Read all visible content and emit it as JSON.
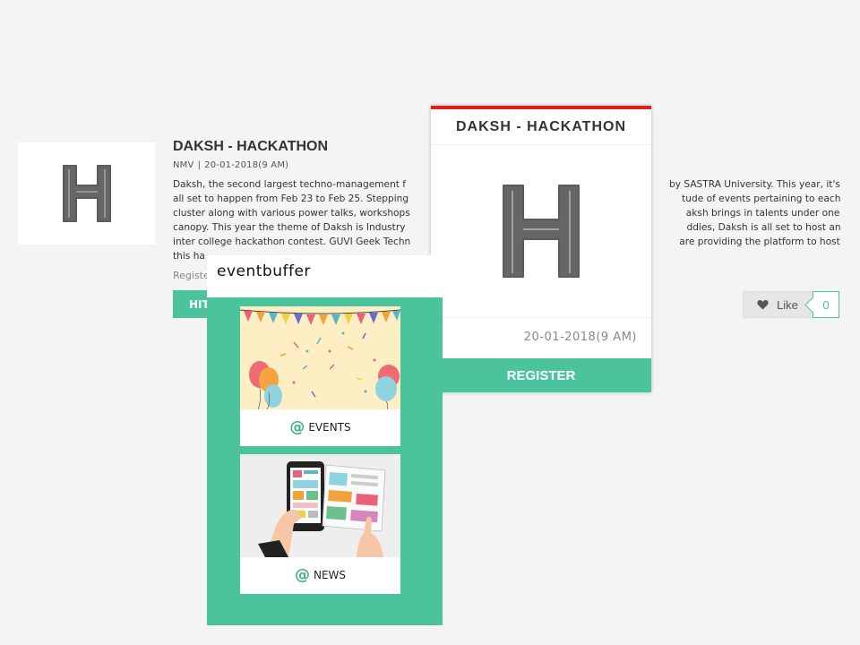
{
  "listing": {
    "title": "DAKSH - HACKATHON",
    "meta_left": "NMV",
    "meta_sep": "|",
    "meta_date": "20-01-2018(9 AM)",
    "desc_lines": [
      [
        "Daksh, the second largest techno-management f",
        "by SASTRA University. This year, it's"
      ],
      [
        "all set to happen from Feb 23 to Feb 25. Stepping",
        "tude of events pertaining to each"
      ],
      [
        "cluster along with various power talks, workshops",
        "aksh brings in talents under one"
      ],
      [
        "canopy. This year the theme of Daksh is Industry",
        "ddies, Daksh is all set to host an"
      ],
      [
        "inter college hackathon contest. GUVI Geek Techn",
        "are providing the platform to host"
      ],
      [
        "this ha",
        ""
      ]
    ],
    "register_text": "Registe",
    "hit_label": "HIT",
    "like_label": "Like",
    "like_count": "0"
  },
  "card": {
    "title": "DAKSH - HACKATHON",
    "date": "20-01-2018(9 AM)",
    "register_label": "REGISTER",
    "accent": "#e02020"
  },
  "popup": {
    "logo": "eventbuffer",
    "tiles": [
      {
        "at": "@",
        "label": "EVENTS"
      },
      {
        "at": "@",
        "label": "NEWS"
      }
    ]
  },
  "colors": {
    "brand_green": "#4bc49d",
    "like_bg": "#e6e6e6"
  },
  "icons": {
    "thumb": "letter-h-icon",
    "like": "heart-icon"
  }
}
